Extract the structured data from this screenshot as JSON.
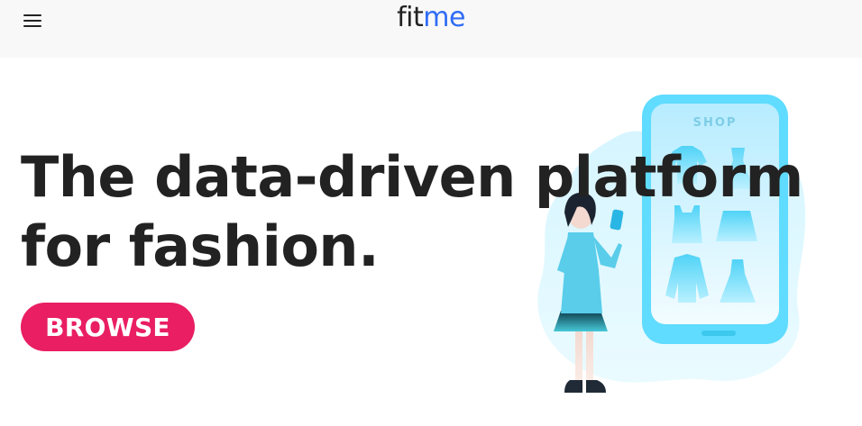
{
  "header": {
    "logo_part1": "fit",
    "logo_part2": "me",
    "menu_icon": "hamburger-menu-icon"
  },
  "hero": {
    "headline_line1": "The data-driven platform",
    "headline_line2": "for fashion.",
    "browse_label": "BROWSE"
  },
  "illustration": {
    "phone_label": "SHOP",
    "items": [
      "tshirt-icon",
      "dress-icon",
      "tank-top-icon",
      "skirt-icon",
      "jacket-icon",
      "gown-icon"
    ]
  },
  "colors": {
    "accent": "#e91e63",
    "logo_blue": "#2f6cf6",
    "text_dark": "#222222",
    "topbar_bg": "#f8f8f8",
    "phone_cyan": "#5fdcff"
  }
}
